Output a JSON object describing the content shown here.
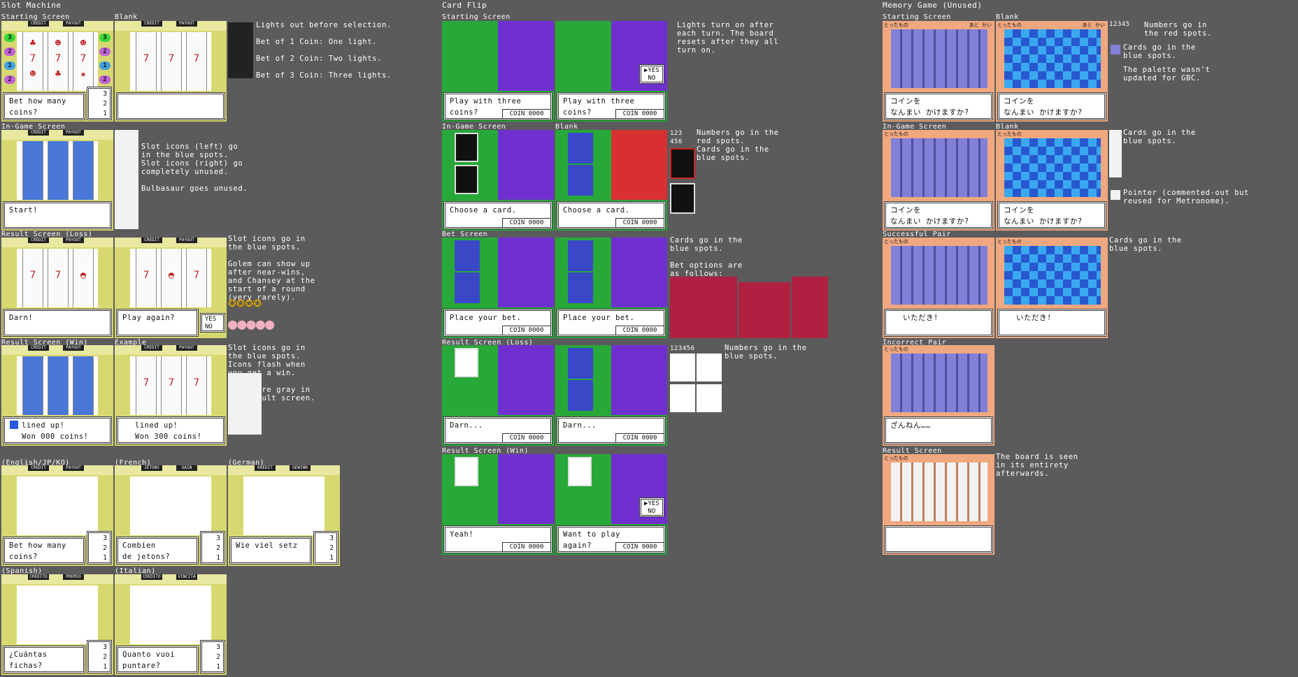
{
  "sections": {
    "slot": "Slot Machine",
    "cardflip": "Card Flip",
    "memory": "Memory Game (Unused)"
  },
  "labels": {
    "starting": "Starting Screen",
    "blank": "Blank",
    "ingame": "In-Game Screen",
    "result_loss": "Result Screen (Loss)",
    "result_win": "Result Screen (Win)",
    "example": "Example",
    "eng": "(English/JP/KO)",
    "fre": "(French)",
    "ger": "(German)",
    "spa": "(Spanish)",
    "ita": "(Italian)",
    "bet_screen": "Bet Screen",
    "successful_pair": "Successful Pair",
    "incorrect_pair": "Incorrect Pair",
    "result_screen": "Result Screen"
  },
  "slot_hud": {
    "credit": "CREDIT",
    "payout": "PAYOUT",
    "fr_credit": "JETONS",
    "fr_payout": "GAIN",
    "de_credit": "KREDIT",
    "de_payout": "GEWINN",
    "es_credit": "CRÉDITO",
    "es_payout": "PREMIO",
    "it_credit": "CREDITO",
    "it_payout": "VINCITA"
  },
  "slot_notes": {
    "lights": "Lights out before selection.\n\nBet of 1 Coin: One light.\n\nBet of 2 Coin: Two lights.\n\nBet of 3 Coin: Three lights.",
    "icons": "Slot icons (left) go\nin the blue spots.\nSlot icons (right) go\ncompletely unused.\n\nBulbasaur goes unused.",
    "loss": "Slot icons go in\nthe blue spots.\n\nGolem can show up\nafter near-wins,\nand Chansey at the\nstart of a round\n(very rarely).",
    "win": "Slot icons go in\nthe blue spots.\nIcons flash when\nyou get a win.\n\nIcons are gray in\nthe result screen."
  },
  "slot_dialogs": {
    "bet_how_many": "Bet how many\ncoins?",
    "start": "Start!",
    "darn": "Darn!",
    "play_again": "Play again?",
    "lined_up": "lined up!\nWon 000 coins!",
    "lined_up_300": "lined up!\nWon 300 coins!",
    "fr": "Combien\nde jetons?",
    "de": "Wie viel setz",
    "es": "¿Cuántas\nfichas?",
    "it": "Quanto vuoi\npuntare?"
  },
  "bet_options": "3\n2\n1",
  "yes_no": "YES\nNO",
  "yes_no_cursor": "▶YES\n NO",
  "cf_notes": {
    "lights": "Lights turn on after\neach turn. The board\nresets after they all\nturn on.",
    "numbers_red": "Numbers go in the\nred spots.\nCards go in the\nblue spots.",
    "bet": "Cards go in the\nblue spots.\n\nBet options are\nas follows:",
    "loss_numbers": "Numbers go in the\nblue spots."
  },
  "cf_dialogs": {
    "play_three": "Play with three\ncoins?",
    "choose": "Choose a card.",
    "place_bet": "Place your bet.",
    "darn": "Darn...",
    "yeah": "Yeah!",
    "want_play": "Want to play\nagain?",
    "coin": "COIN 0000"
  },
  "cf_digits": {
    "row1": "123",
    "row2": "456",
    "loss": "123456"
  },
  "mem_notes": {
    "numbers_red": "Numbers go in\nthe red spots.",
    "cards_blue": "Cards go in the\nblue spots.",
    "palette": "The palette wasn't\nupdated for GBC.",
    "ingame_cards": "Cards go in the\nblue spots.",
    "pointer": "Pointer (commented-out but\nreused for Metronome).",
    "pair_cards": "Cards go in the\nblue spots.",
    "result": "The board is seen\nin its entirety\nafterwards."
  },
  "mem_dialogs": {
    "coin_jp": "コインを\nなんまい かけますか?",
    "itadaki": "いただき!",
    "zannen": "ざんねん……",
    "hdr_left": "とったもの",
    "hdr_right": "あと かい"
  },
  "mem_digits": "12345"
}
